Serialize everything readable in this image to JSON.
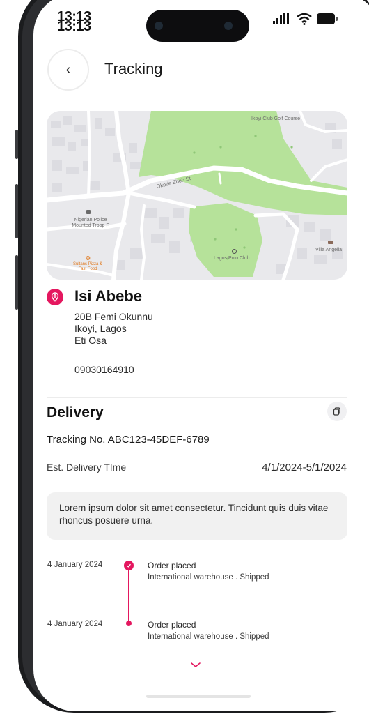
{
  "status_bar": {
    "time": "13:13"
  },
  "header": {
    "back_label": "‹",
    "title": "Tracking"
  },
  "map": {
    "labels": {
      "golf": "Ikoyi Club Golf Course",
      "street": "Okotie Eboh St",
      "police": "Nigerian Police Mounted Troop F",
      "pizza": "Sultans Pizza & Fast Food",
      "polo": "Lagos Polo Club",
      "villa": "Villa Angelia"
    }
  },
  "address": {
    "name": "Isi Abebe",
    "line1": "20B Femi Okunnu",
    "line2": "Ikoyi, Lagos",
    "line3": "Eti Osa",
    "phone": "09030164910"
  },
  "delivery": {
    "title": "Delivery",
    "tracking": "Tracking No. ABC123-45DEF-6789",
    "est_label": "Est. Delivery TIme",
    "est_value": "4/1/2024-5/1/2024",
    "note": "Lorem ipsum dolor sit amet consectetur. Tincidunt quis duis vitae rhoncus posuere urna."
  },
  "timeline": [
    {
      "date": "4 January 2024",
      "title": "Order placed",
      "sub": "International warehouse . Shipped"
    },
    {
      "date": "4 January 2024",
      "title": "Order placed",
      "sub": "International warehouse . Shipped"
    }
  ],
  "colors": {
    "accent": "#e4175f",
    "map_green": "#b6e29a",
    "map_bg": "#e9e9ec"
  }
}
